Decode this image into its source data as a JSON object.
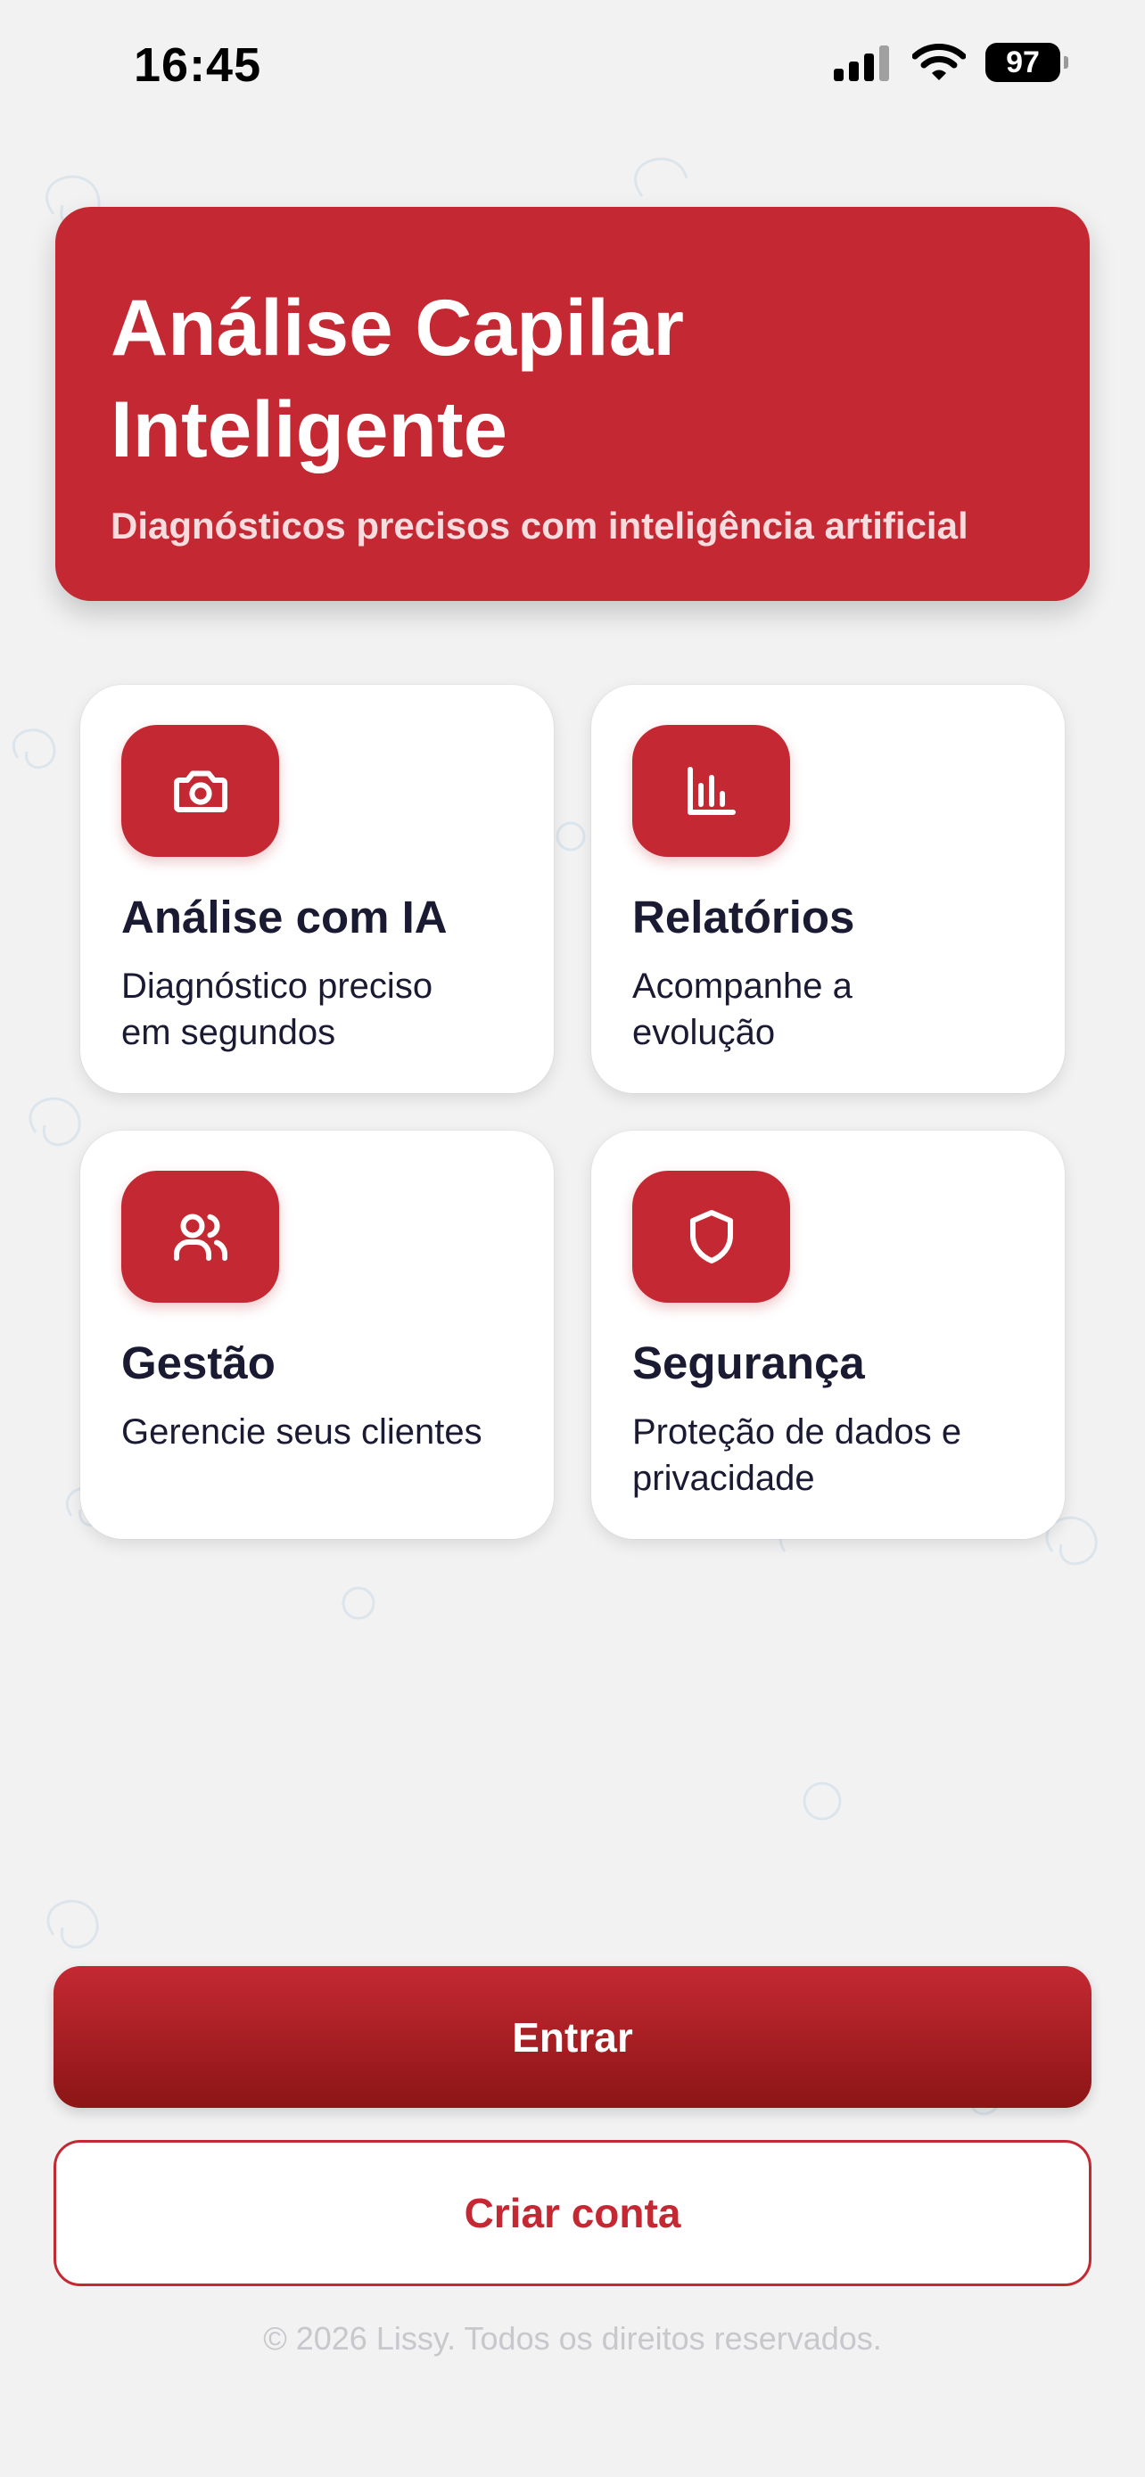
{
  "status_bar": {
    "time": "16:45",
    "battery": "97"
  },
  "hero": {
    "title_line1": "Análise Capilar",
    "title_line2": "Inteligente",
    "subtitle": "Diagnósticos precisos com inteligência artificial"
  },
  "features": [
    {
      "icon": "camera-icon",
      "title": "Análise com IA",
      "desc_line1": "Diagnóstico preciso",
      "desc_line2": "em segundos"
    },
    {
      "icon": "bar-chart-icon",
      "title": "Relatórios",
      "desc_line1": "Acompanhe a",
      "desc_line2": "evolução"
    },
    {
      "icon": "users-icon",
      "title": "Gestão",
      "desc_line1": "Gerencie seus clientes",
      "desc_line2": ""
    },
    {
      "icon": "shield-icon",
      "title": "Segurança",
      "desc_line1": "Proteção de dados e",
      "desc_line2": "privacidade"
    }
  ],
  "actions": {
    "login_label": "Entrar",
    "signup_label": "Criar conta"
  },
  "footer": {
    "copyright": "© 2026 Lissy. Todos os direitos reservados."
  },
  "colors": {
    "brand": "#c42933",
    "brand_dark": "#8c1515",
    "text": "#1b1a33",
    "background": "#f2f2f3"
  }
}
